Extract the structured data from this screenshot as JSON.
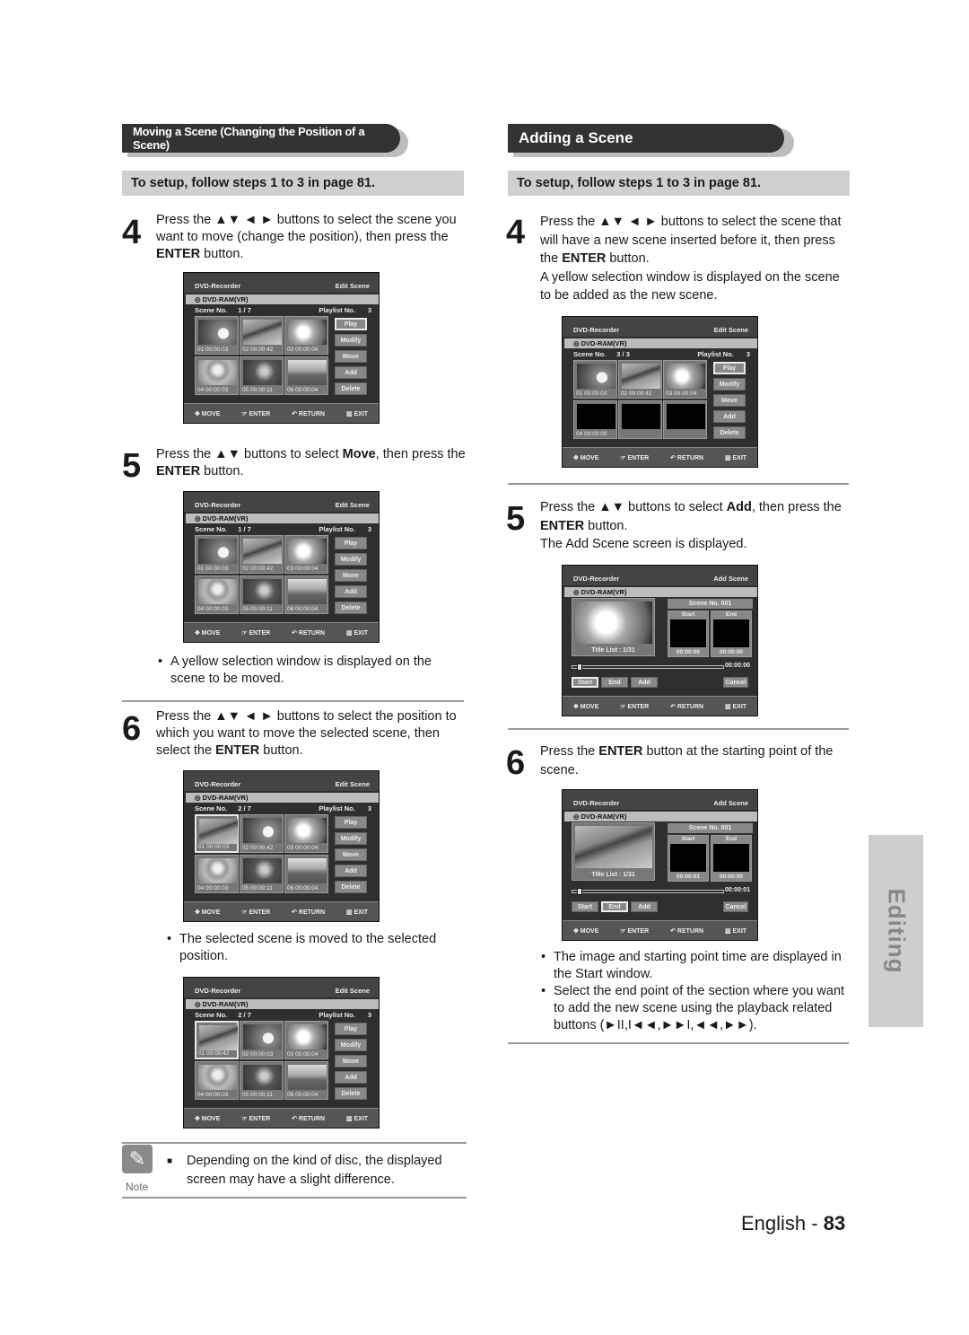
{
  "left": {
    "section_title": "Moving a Scene (Changing the Position of a Scene)",
    "setup": "To setup, follow steps 1 to 3 in page 81.",
    "step4": {
      "num": "4",
      "pre": "Press the ▲▼ ◄ ► buttons to select the scene you want to move (change the position), then press the ",
      "bold": "ENTER",
      "post": " button."
    },
    "step5": {
      "num": "5",
      "pre": "Press the ▲▼ buttons to select ",
      "bold1": "Move",
      "mid": ", then press the ",
      "bold2": "ENTER",
      "post": " button."
    },
    "step5_bullet": "A yellow selection window is displayed on the scene to be moved.",
    "step6": {
      "num": "6",
      "pre": "Press the ▲▼ ◄ ► buttons to select the position to which you want to move the selected scene, then select the ",
      "bold": "ENTER",
      "post": " button."
    },
    "step6_bullet": "The selected scene is moved to the selected position.",
    "note": {
      "icon": "pencil-icon",
      "label": "Note",
      "text": "Depending on the kind of disc, the displayed screen may have a slight difference."
    }
  },
  "right": {
    "section_title": "Adding a Scene",
    "setup": "To setup, follow steps 1 to 3 in page 81.",
    "step4": {
      "num": "4",
      "pre": "Press the ▲▼ ◄ ► buttons to select the scene that will have a new scene inserted before it, then press the ",
      "bold": "ENTER",
      "post": " button.",
      "extra": "A yellow selection window is displayed on the scene to be added as the new scene."
    },
    "step5": {
      "num": "5",
      "pre": "Press the ▲▼ buttons to select ",
      "bold1": "Add",
      "mid": ", then press the ",
      "bold2": "ENTER",
      "post": " button.",
      "extra": "The Add Scene screen is displayed."
    },
    "step6": {
      "num": "6",
      "pre": "Press the ",
      "bold": "ENTER",
      "post": " button at the starting point of the scene."
    },
    "step6_bullets": [
      "The image and starting point time are displayed in the Start window.",
      "Select the end point of the section where you want to add the new scene using the playback related buttons (►II,I◄◄,►►I,◄◄,►►)."
    ]
  },
  "osd_common": {
    "device": "DVD-Recorder",
    "disc": "DVD-RAM(VR)",
    "scene_no_label": "Scene No.",
    "playlist_label": "Playlist No.",
    "playlist_no": "3",
    "buttons": [
      "Play",
      "Modify",
      "Move",
      "Add",
      "Delete"
    ],
    "footer": [
      "✥ MOVE",
      "☞ ENTER",
      "↶ RETURN",
      "▥ EXIT"
    ]
  },
  "edit_screens": [
    {
      "mode": "Edit Scene",
      "scene": "1 / 7",
      "selected_button": "Play",
      "thumbs": [
        [
          "01",
          "00:00:03",
          "leaf"
        ],
        [
          "02",
          "00:00:42",
          "dolphin"
        ],
        [
          "03",
          "00:00:04",
          "lily"
        ],
        [
          "04",
          "00:00:03",
          "flower"
        ],
        [
          "05",
          "00:00:11",
          "roses"
        ],
        [
          "06",
          "00:00:04",
          "field"
        ]
      ]
    },
    {
      "mode": "Edit Scene",
      "scene": "1 / 7",
      "selected_button": "",
      "thumbs": [
        [
          "01",
          "00:00:03",
          "leaf"
        ],
        [
          "02",
          "00:00:42",
          "dolphin"
        ],
        [
          "03",
          "00:00:04",
          "lily"
        ],
        [
          "04",
          "00:00:03",
          "flower"
        ],
        [
          "05",
          "00:00:11",
          "roses"
        ],
        [
          "06",
          "00:00:04",
          "field"
        ]
      ]
    },
    {
      "mode": "Edit Scene",
      "scene": "2 / 7",
      "selected_button": "",
      "thumbs": [
        [
          "01",
          "00:00:03",
          "dolphin"
        ],
        [
          "02",
          "00:00:42",
          "leaf"
        ],
        [
          "03",
          "00:00:04",
          "lily"
        ],
        [
          "04",
          "00:00:03",
          "flower"
        ],
        [
          "05",
          "00:00:11",
          "roses"
        ],
        [
          "06",
          "00:00:04",
          "field"
        ]
      ]
    },
    {
      "mode": "Edit Scene",
      "scene": "2 / 7",
      "selected_button": "",
      "thumbs": [
        [
          "01",
          "00:00:42",
          "dolphin"
        ],
        [
          "02",
          "00:00:03",
          "leaf"
        ],
        [
          "03",
          "00:00:04",
          "lily"
        ],
        [
          "04",
          "00:00:03",
          "flower"
        ],
        [
          "05",
          "00:00:11",
          "roses"
        ],
        [
          "06",
          "00:00:04",
          "field"
        ]
      ]
    },
    {
      "mode": "Edit Scene",
      "scene": "3 / 3",
      "selected_button": "Play",
      "thumbs": [
        [
          "01",
          "00:00:03",
          "leaf"
        ],
        [
          "02",
          "00:00:42",
          "dolphin"
        ],
        [
          "03",
          "00:00:04",
          "lily"
        ],
        [
          "04",
          "00:00:00",
          "black"
        ],
        [
          "",
          "",
          "black"
        ],
        [
          "",
          "",
          "black"
        ]
      ]
    }
  ],
  "add_screens": [
    {
      "mode": "Add Scene",
      "title_list": "Title List : 1/31",
      "scene_no": "Scene No. 001",
      "start_label": "Start",
      "end_label": "End",
      "start_time": "00:00:00",
      "end_time": "00:00:00",
      "current_time": "00:00:00",
      "preview": "lily",
      "start_img": "black",
      "selected": "Start",
      "buttons": [
        "Start",
        "End",
        "Add"
      ],
      "cancel": "Cancel"
    },
    {
      "mode": "Add Scene",
      "title_list": "Title List : 1/31",
      "scene_no": "Scene No. 001",
      "start_label": "Start",
      "end_label": "End",
      "start_time": "00:00:01",
      "end_time": "00:00:00",
      "current_time": "00:00:01",
      "preview": "dolphin",
      "start_img": "dolphin",
      "selected": "End",
      "buttons": [
        "Start",
        "End",
        "Add"
      ],
      "cancel": "Cancel"
    }
  ],
  "side_tab": "Editing",
  "footer": {
    "lang": "English",
    "sep": " - ",
    "page": "83"
  }
}
